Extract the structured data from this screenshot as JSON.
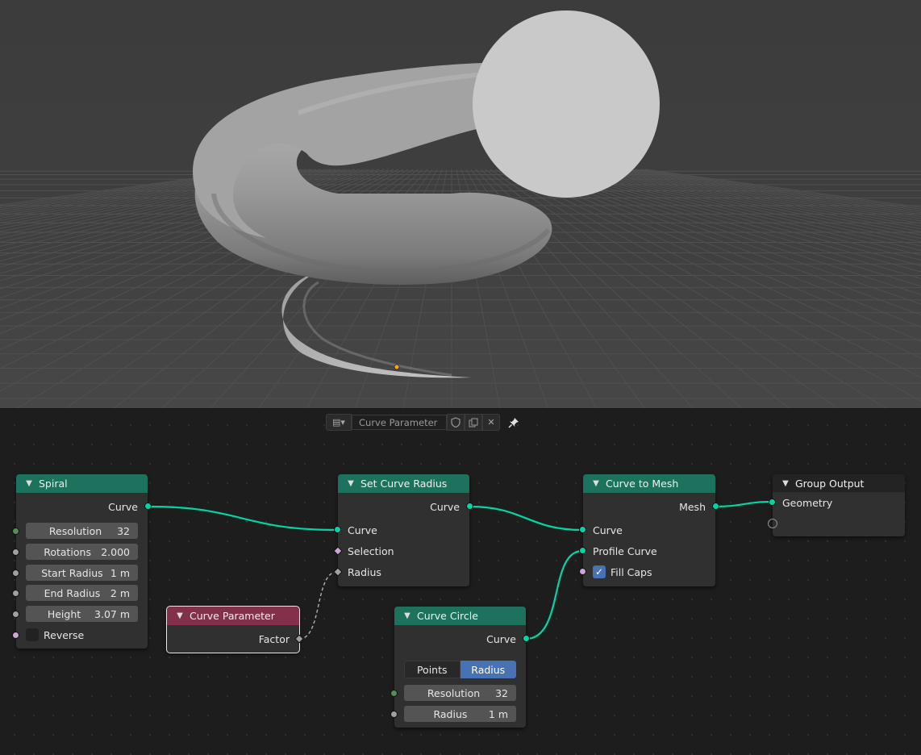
{
  "editor_header": {
    "tree_name": "Curve Parameter",
    "editor_type_icon": "node-editor-icon",
    "fake_user_icon": "shield-icon",
    "duplicate_icon": "duplicate-icon",
    "unlink_icon": "close-icon",
    "pin_icon": "pin-icon"
  },
  "colors": {
    "geometry_header": "#1d725e",
    "input_header": "#83314a",
    "geometry_socket": "#00d6a3",
    "link": "#00d6a3",
    "accent": "#4772b3"
  },
  "nodes": {
    "spiral": {
      "title": "Spiral",
      "output": "Curve",
      "fields": [
        {
          "label": "Resolution",
          "value": "32"
        },
        {
          "label": "Rotations",
          "value": "2.000"
        },
        {
          "label": "Start Radius",
          "value": "1 m"
        },
        {
          "label": "End Radius",
          "value": "2 m"
        },
        {
          "label": "Height",
          "value": "3.07 m"
        }
      ],
      "reverse_label": "Reverse",
      "reverse_checked": false
    },
    "curve_parameter": {
      "title": "Curve Parameter",
      "output": "Factor"
    },
    "set_curve_radius": {
      "title": "Set Curve Radius",
      "output": "Curve",
      "inputs": [
        "Curve",
        "Selection",
        "Radius"
      ]
    },
    "curve_circle": {
      "title": "Curve Circle",
      "output": "Curve",
      "modes": [
        "Points",
        "Radius"
      ],
      "active_mode": "Radius",
      "fields": [
        {
          "label": "Resolution",
          "value": "32"
        },
        {
          "label": "Radius",
          "value": "1 m"
        }
      ]
    },
    "curve_to_mesh": {
      "title": "Curve to Mesh",
      "output": "Mesh",
      "inputs": [
        "Curve",
        "Profile Curve"
      ],
      "fill_caps_label": "Fill Caps",
      "fill_caps_checked": true
    },
    "group_output": {
      "title": "Group Output",
      "input": "Geometry"
    }
  }
}
